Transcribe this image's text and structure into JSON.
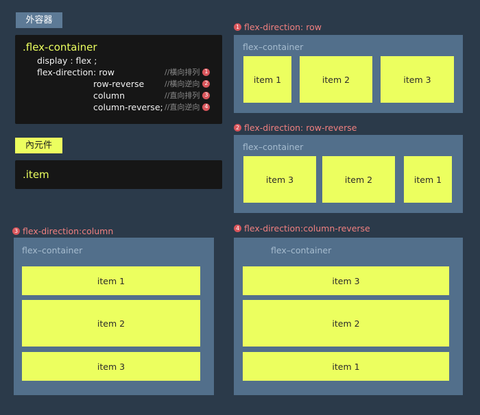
{
  "outer_tag": "外容器",
  "inner_tag": "內元件",
  "code": {
    "selector": ".flex-container",
    "display_line": "display : flex ;",
    "direction_line": "flex-direction: row",
    "values": [
      "row-reverse",
      "column",
      "column-reverse;"
    ],
    "comments": [
      "//橫向排列",
      "//橫向逆向",
      "//直向排列",
      "//直向逆向"
    ],
    "badges": [
      "1",
      "2",
      "3",
      "4"
    ]
  },
  "item_selector": ".item",
  "diagrams": {
    "row": {
      "badge": "1",
      "title": "flex-direction: row",
      "container_label": "flex–container",
      "items": [
        "item 1",
        "item 2",
        "item 3"
      ]
    },
    "row_reverse": {
      "badge": "2",
      "title": "flex-direction: row-reverse",
      "container_label": "flex–container",
      "items": [
        "item 3",
        "item 2",
        "item 1"
      ]
    },
    "column": {
      "badge": "3",
      "title": "flex-direction:column",
      "container_label": "flex–container",
      "items": [
        "item 1",
        "item 2",
        "item 3"
      ]
    },
    "column_reverse": {
      "badge": "4",
      "title": "flex-direction:column-reverse",
      "container_label": "flex–container",
      "items": [
        "item 3",
        "item 2",
        "item 1"
      ]
    }
  },
  "colors": {
    "background": "#2b3a4a",
    "container": "#526f8b",
    "item": "#ecff5f",
    "heading": "#f08080",
    "badge": "#d9555b",
    "code_bg": "#161616"
  }
}
